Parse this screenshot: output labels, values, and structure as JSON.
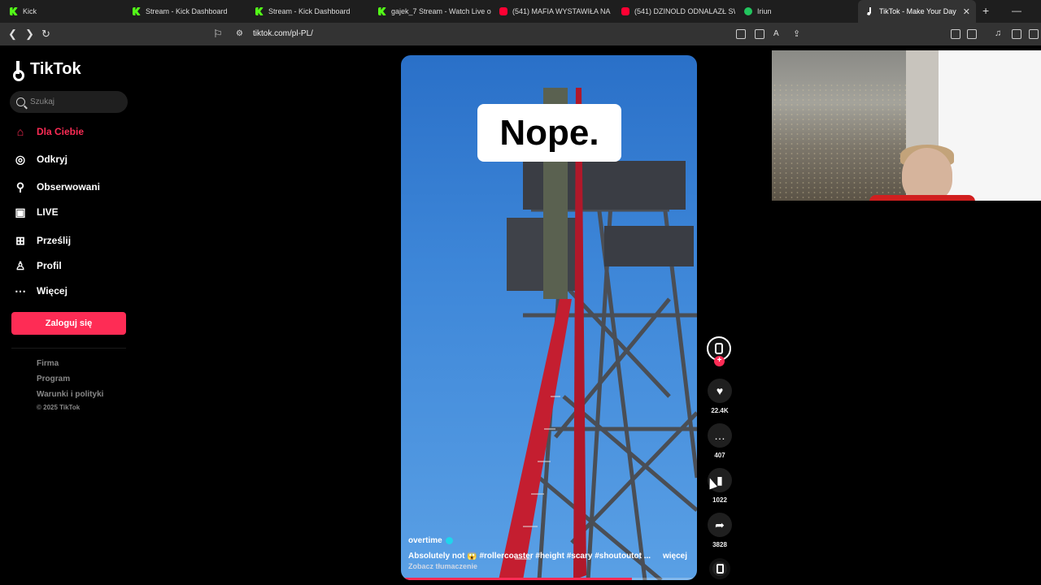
{
  "browser": {
    "tabs": [
      {
        "title": "Kick",
        "favicon": "kick-icon"
      },
      {
        "title": "Stream - Kick Dashboard",
        "favicon": "kick-icon"
      },
      {
        "title": "Stream - Kick Dashboard",
        "favicon": "kick-icon"
      },
      {
        "title": "gajek_7 Stream - Watch Live o",
        "favicon": "kick-icon"
      },
      {
        "title": "(541) MAFIA WYSTAWIŁA NA",
        "favicon": "youtube-icon"
      },
      {
        "title": "(541) DZINOLD ODNALAZŁ SW",
        "favicon": "youtube-icon"
      },
      {
        "title": "Iriun",
        "favicon": "green-dot-icon"
      },
      {
        "title": "TikTok - Make Your Day",
        "favicon": "tiktok-icon",
        "active": true
      }
    ],
    "url": "tiktok.com/pl-PL/"
  },
  "sidebar": {
    "logo": "TikTok",
    "search_placeholder": "Szukaj",
    "nav": [
      {
        "label": "Dla Ciebie",
        "icon": "home-icon",
        "active": true
      },
      {
        "label": "Odkryj",
        "icon": "compass-icon"
      },
      {
        "label": "Obserwowani",
        "icon": "user-follow-icon"
      },
      {
        "label": "LIVE",
        "icon": "live-tv-icon"
      },
      {
        "label": "Prześlij",
        "icon": "upload-plus-icon"
      },
      {
        "label": "Profil",
        "icon": "profile-icon"
      },
      {
        "label": "Więcej",
        "icon": "more-dots-icon"
      }
    ],
    "login_label": "Zaloguj się",
    "footer": [
      "Firma",
      "Program",
      "Warunki i polityki"
    ],
    "copyright": "© 2025 TikTok"
  },
  "video": {
    "overlay_text": "Nope.",
    "author": "overtime",
    "description": "Absolutely not 😱 #rollercoaster #height #scary #shoutoutot ...",
    "more_label": "więcej",
    "translate_label": "Zobacz tłumaczenie",
    "progress": 0.78
  },
  "actions": {
    "likes": "22.4K",
    "comments": "407",
    "saves": "1022",
    "shares": "3828"
  },
  "colors": {
    "accent": "#fe2c55",
    "background": "#000000"
  }
}
